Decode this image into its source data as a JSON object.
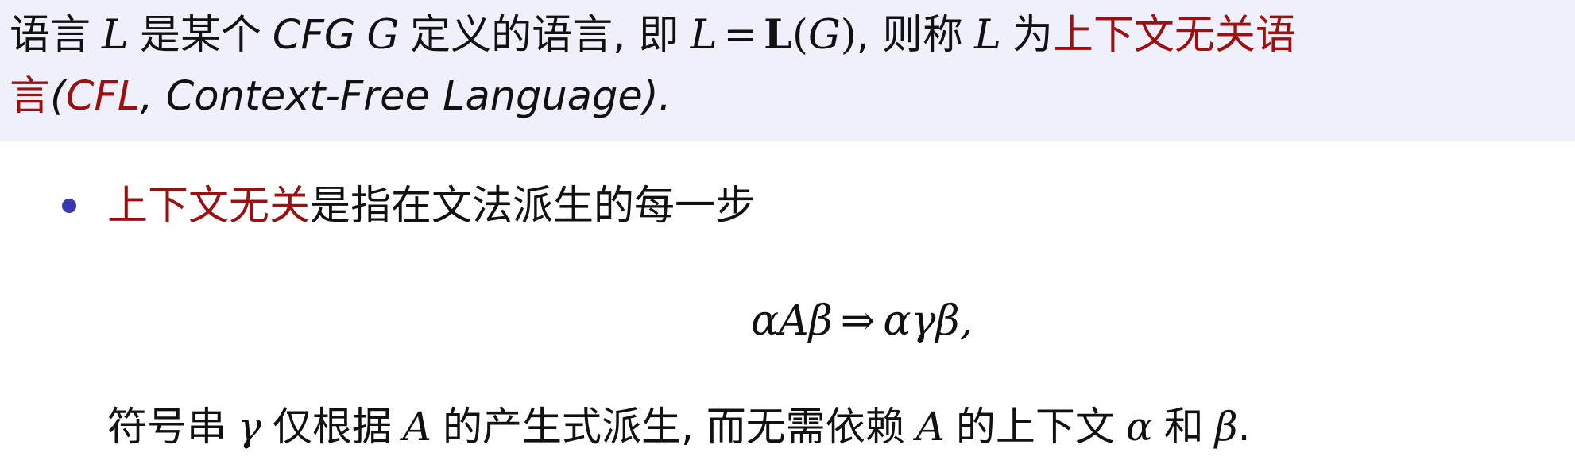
{
  "definition": {
    "p1": "语言",
    "L": "L",
    "p2": "是某个",
    "cfg": "CFG",
    "G": "G",
    "p3": "定义的语言, 即",
    "eq_lhs": "L",
    "eq_sign": "=",
    "eq_bold_L": "L",
    "eq_paren_open": "(",
    "eq_G": "G",
    "eq_paren_close": ")",
    "p4": ", 则称",
    "L2": "L",
    "p5": "为",
    "term_highlight_1": "上下文无关语",
    "term_highlight_2": "言",
    "paren_open": "(",
    "abbr": "CFL",
    "full_name": ", Context-Free Language).",
    "highlight_color": "#9b1010",
    "background_color": "#f0f0fb"
  },
  "bullet": {
    "highlight": "上下文无关",
    "text": "是指在文法派生的每一步",
    "bullet_color": "#3a3ab0"
  },
  "formula": {
    "lhs": "αAβ",
    "arrow": "⇒",
    "rhs": "αγβ,"
  },
  "explanation": {
    "t1": "符号串",
    "gamma": "γ",
    "t2": "仅根据",
    "A1": "A",
    "t3": "的产生式派生, 而无需依赖",
    "A2": "A",
    "t4": "的上下文",
    "alpha": "α",
    "t5": "和",
    "beta": "β",
    "t6": "."
  }
}
